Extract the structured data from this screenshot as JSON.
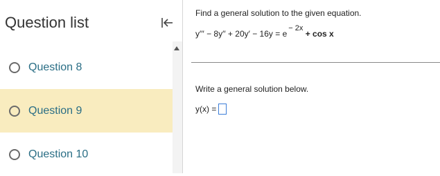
{
  "sidebar": {
    "title": "Question list",
    "items": [
      {
        "label": "Question 8",
        "active": false
      },
      {
        "label": "Question 9",
        "active": true
      },
      {
        "label": "Question 10",
        "active": false
      }
    ],
    "active_color": "#f9ecbf",
    "link_color": "#2a6e85"
  },
  "question": {
    "prompt": "Find a general solution to the given equation.",
    "equation_main": "y′′′ − 8y′′ + 20y′ − 16y = e",
    "equation_exponent": "− 2x",
    "equation_tail": "+ cos x",
    "instruction": "Write a general solution below.",
    "answer_label": "y(x) ="
  }
}
